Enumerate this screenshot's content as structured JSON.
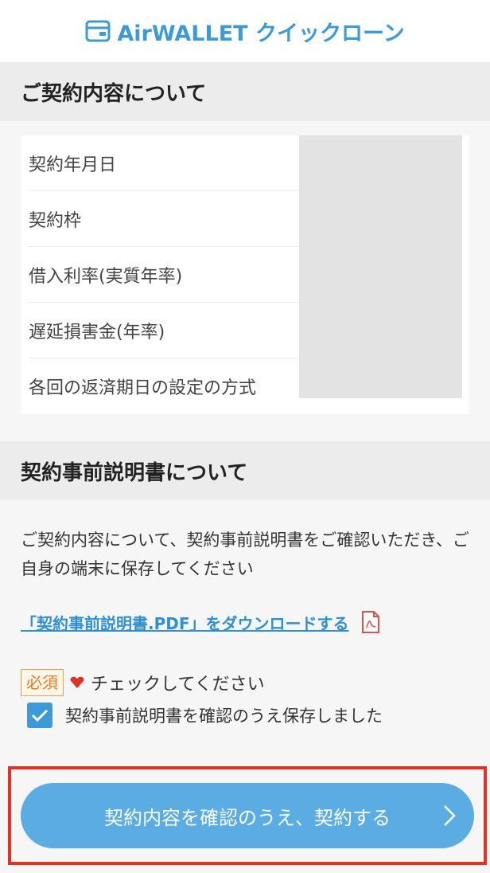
{
  "header": {
    "logo_text": "AirWALLET クイックローン"
  },
  "contract_section": {
    "title": "ご契約内容について",
    "rows": [
      {
        "label": "契約年月日"
      },
      {
        "label": "契約枠"
      },
      {
        "label": "借入利率(実質年率)"
      },
      {
        "label": "遅延損害金(年率)"
      },
      {
        "label": "各回の返済期日の設定の方式"
      }
    ]
  },
  "explanation_section": {
    "title": "契約事前説明書について",
    "description": "ご契約内容について、契約事前説明書をご確認いただき、ご自身の端末に保存してください",
    "pdf_link": "「契約事前説明書.PDF」をダウンロードする",
    "required_badge": "必須",
    "check_prompt": "チェックしてください",
    "checkbox_label": "契約事前説明書を確認のうえ保存しました",
    "checkbox_checked": true
  },
  "cta": {
    "label": "契約内容を確認のうえ、契約する"
  },
  "colors": {
    "brand_blue": "#3d9ad6",
    "button_blue": "#5aace2",
    "highlight_red": "#e03127",
    "required_orange": "#e07b20"
  },
  "icons": {
    "logo": "wallet-icon",
    "pdf": "pdf-icon",
    "heart": "heart-icon",
    "check": "check-icon",
    "chevron": "chevron-right-icon"
  }
}
